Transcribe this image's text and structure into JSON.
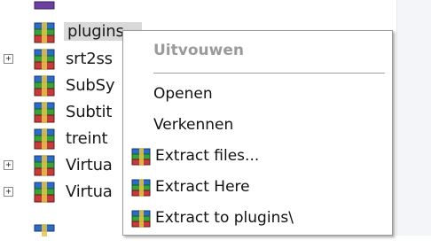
{
  "tree": {
    "rows": [
      {
        "label": "plugins...",
        "expandable": false,
        "selected": true
      },
      {
        "label": "srt2ss",
        "expandable": true,
        "selected": false
      },
      {
        "label": "SubSy",
        "expandable": false,
        "selected": false
      },
      {
        "label": "Subtit",
        "expandable": false,
        "selected": false
      },
      {
        "label": "treint",
        "expandable": false,
        "selected": false
      },
      {
        "label": "Virtua",
        "expandable": true,
        "selected": false
      },
      {
        "label": "Virtua",
        "expandable": true,
        "selected": false
      }
    ]
  },
  "context_menu": {
    "header": "Uitvouwen",
    "items": [
      {
        "label": "Openen",
        "icon": "none"
      },
      {
        "label": "Verkennen",
        "icon": "none"
      },
      {
        "label": "Extract files...",
        "icon": "winrar-icon"
      },
      {
        "label": "Extract Here",
        "icon": "winrar-icon"
      },
      {
        "label": "Extract to plugins\\",
        "icon": "winrar-icon"
      }
    ]
  },
  "colors": {
    "selection": "#d9d9d9",
    "menu_border": "#9a9a9a",
    "disabled_text": "#9a9a9a"
  }
}
